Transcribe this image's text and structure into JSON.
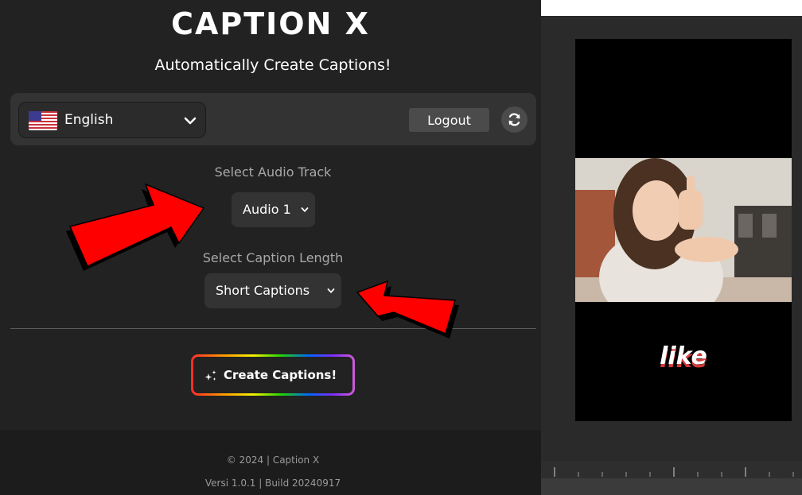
{
  "app": {
    "logo_text": "CAPTION X",
    "tagline": "Automatically Create Captions!"
  },
  "toolbar": {
    "language": {
      "selected": "English",
      "flag_icon": "us-flag-icon"
    },
    "logout_label": "Logout",
    "refresh_icon": "refresh-icon"
  },
  "audio_track": {
    "label": "Select Audio Track",
    "selected": "Audio 1"
  },
  "caption_length": {
    "label": "Select Caption Length",
    "selected": "Short Captions"
  },
  "create_button": {
    "label": "Create Captions!",
    "icon": "sparkle-icon"
  },
  "footer": {
    "copyright": "© 2024 | Caption X",
    "version": "Versi 1.0.1 | Build 20240917"
  },
  "preview": {
    "caption_word": "like"
  },
  "colors": {
    "panel_bg": "#222222",
    "control_bg": "#333333",
    "arrow": "#ff0000",
    "caption_shadow": "#d43a3a"
  }
}
